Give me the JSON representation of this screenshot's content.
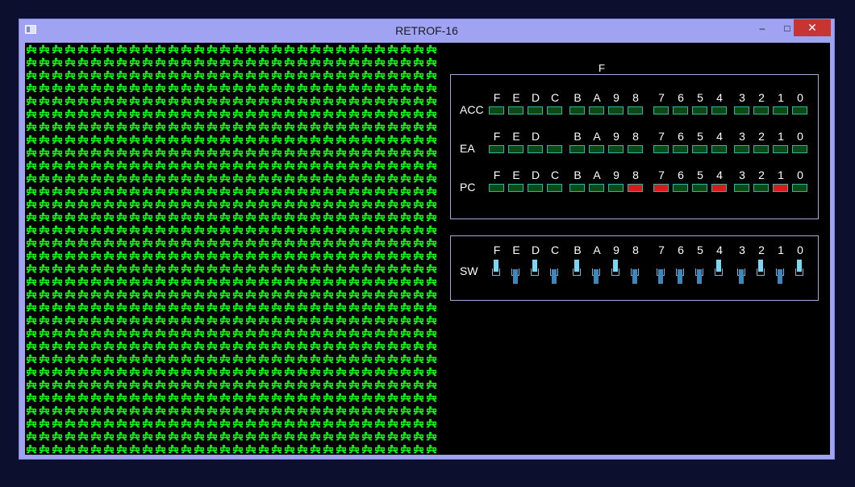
{
  "window": {
    "title": "RETROF-16",
    "minimize_glyph": "–",
    "maximize_glyph": "□",
    "close_glyph": "✕"
  },
  "colors": {
    "invader": "#13ff13",
    "led_off": "#0a4a14",
    "led_on": "#d91a1a",
    "led_border": "#2fb3a2"
  },
  "invader_grid": {
    "icon": "space-invader-icon",
    "columns": 32,
    "rows": 32
  },
  "flag_label": "F",
  "registers": [
    {
      "name": "ACC",
      "bit_labels": [
        "F",
        "E",
        "D",
        "C",
        "B",
        "A",
        "9",
        "8",
        "7",
        "6",
        "5",
        "4",
        "3",
        "2",
        "1",
        "0"
      ],
      "leds": [
        0,
        0,
        0,
        0,
        0,
        0,
        0,
        0,
        0,
        0,
        0,
        0,
        0,
        0,
        0,
        0
      ]
    },
    {
      "name": "EA",
      "bit_labels": [
        "F",
        "E",
        "D",
        "",
        "B",
        "A",
        "9",
        "8",
        "7",
        "6",
        "5",
        "4",
        "3",
        "2",
        "1",
        "0"
      ],
      "leds": [
        0,
        0,
        0,
        0,
        0,
        0,
        0,
        0,
        0,
        0,
        0,
        0,
        0,
        0,
        0,
        0
      ]
    },
    {
      "name": "PC",
      "bit_labels": [
        "F",
        "E",
        "D",
        "C",
        "B",
        "A",
        "9",
        "8",
        "7",
        "6",
        "5",
        "4",
        "3",
        "2",
        "1",
        "0"
      ],
      "leds": [
        0,
        0,
        0,
        0,
        0,
        0,
        0,
        1,
        1,
        0,
        0,
        1,
        0,
        0,
        1,
        0
      ]
    }
  ],
  "switches": {
    "name": "SW",
    "bit_labels": [
      "F",
      "E",
      "D",
      "C",
      "B",
      "A",
      "9",
      "8",
      "7",
      "6",
      "5",
      "4",
      "3",
      "2",
      "1",
      "0"
    ],
    "states": [
      1,
      0,
      1,
      0,
      1,
      0,
      1,
      0,
      0,
      0,
      0,
      1,
      0,
      1,
      0,
      1
    ]
  }
}
